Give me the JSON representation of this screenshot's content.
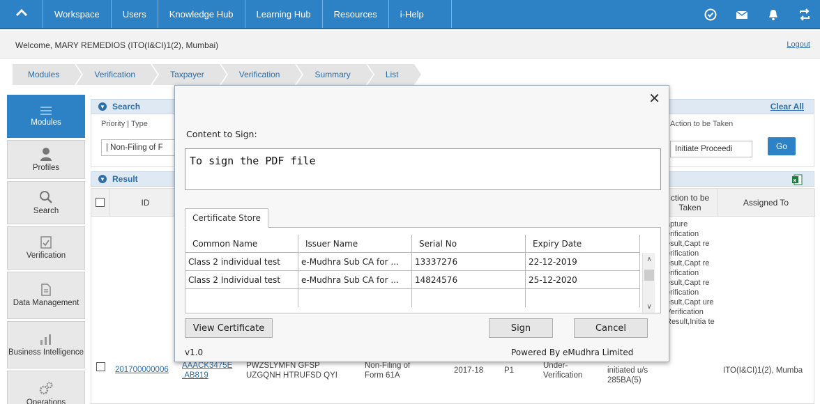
{
  "topnav": {
    "items": [
      "Workspace",
      "Users",
      "Knowledge Hub",
      "Learning Hub",
      "Resources",
      "i-Help"
    ]
  },
  "welcome": {
    "text": "Welcome, MARY REMEDIOS (ITO(I&CI)1(2), Mumbai)",
    "logout": "Logout"
  },
  "breadcrumb": [
    "Modules",
    "Verification",
    "Taxpayer",
    "Verification",
    "Summary",
    "List"
  ],
  "sidebar": {
    "items": [
      {
        "label": "Modules",
        "icon": "menu-icon"
      },
      {
        "label": "Profiles",
        "icon": "person-icon"
      },
      {
        "label": "Search",
        "icon": "search-icon"
      },
      {
        "label": "Verification",
        "icon": "verification-icon"
      },
      {
        "label": "Data Management",
        "icon": "document-icon"
      },
      {
        "label": "Business Intelligence",
        "icon": "bi-icon"
      },
      {
        "label": "Operations",
        "icon": "gears-icon"
      }
    ]
  },
  "search": {
    "title": "Search",
    "clear_all": "Clear All",
    "priority_label": "Priority | Type",
    "priority_value": "| Non-Filing of F",
    "action_label": "Action to be Taken",
    "action_value": "Initiate Proceedi",
    "go": "Go"
  },
  "result": {
    "title": "Result",
    "headers": {
      "id": "ID",
      "action": "ction to be Taken",
      "assigned": "Assigned To"
    },
    "row": {
      "id": "201700000006",
      "pan": "AAACK3475E .AB819",
      "name": "PWZSLYMFN GFSP UZGQNH HTRUFSD QYI",
      "type": "Non-Filing of Form 61A",
      "year": "2017-18",
      "priority": "P1",
      "status": "Under-Verification",
      "action_taken": "initiated u/s 285BA(5)",
      "action": "apture erification esult,Capt re erification esult,Capt re erification esult,Capt re erification esult,Capt ure Verification Result,Initia te",
      "assigned": "ITO(I&CI)1(2), Mumba"
    }
  },
  "dialog": {
    "content_label": "Content to Sign:",
    "content_text": "To sign the PDF file",
    "tab": "Certificate Store",
    "columns": [
      "Common Name",
      "Issuer Name",
      "Serial No",
      "Expiry Date"
    ],
    "rows": [
      [
        "Class 2 individual test",
        "e-Mudhra Sub CA for ...",
        "13337276",
        "22-12-2019"
      ],
      [
        "Class 2 Individual test",
        "e-Mudhra Sub CA for ...",
        "14824576",
        "25-12-2020"
      ],
      [
        "",
        "",
        "",
        ""
      ]
    ],
    "view_certificate": "View Certificate",
    "sign": "Sign",
    "cancel": "Cancel",
    "version": "v1.0",
    "powered_by": "Powered By eMudhra Limited"
  }
}
